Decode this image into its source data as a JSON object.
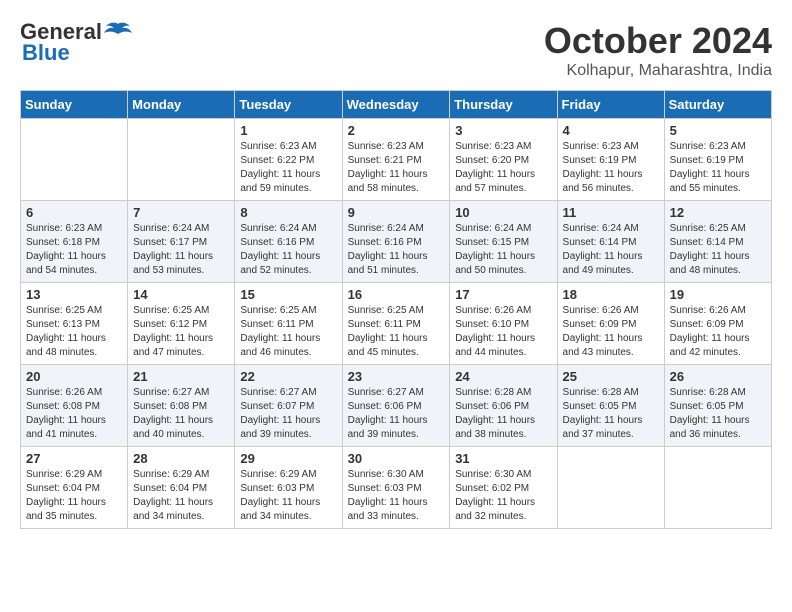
{
  "header": {
    "logo_line1": "General",
    "logo_line2": "Blue",
    "month_title": "October 2024",
    "location": "Kolhapur, Maharashtra, India"
  },
  "days_of_week": [
    "Sunday",
    "Monday",
    "Tuesday",
    "Wednesday",
    "Thursday",
    "Friday",
    "Saturday"
  ],
  "weeks": [
    [
      {
        "day": "",
        "sunrise": "",
        "sunset": "",
        "daylight": ""
      },
      {
        "day": "",
        "sunrise": "",
        "sunset": "",
        "daylight": ""
      },
      {
        "day": "1",
        "sunrise": "Sunrise: 6:23 AM",
        "sunset": "Sunset: 6:22 PM",
        "daylight": "Daylight: 11 hours and 59 minutes."
      },
      {
        "day": "2",
        "sunrise": "Sunrise: 6:23 AM",
        "sunset": "Sunset: 6:21 PM",
        "daylight": "Daylight: 11 hours and 58 minutes."
      },
      {
        "day": "3",
        "sunrise": "Sunrise: 6:23 AM",
        "sunset": "Sunset: 6:20 PM",
        "daylight": "Daylight: 11 hours and 57 minutes."
      },
      {
        "day": "4",
        "sunrise": "Sunrise: 6:23 AM",
        "sunset": "Sunset: 6:19 PM",
        "daylight": "Daylight: 11 hours and 56 minutes."
      },
      {
        "day": "5",
        "sunrise": "Sunrise: 6:23 AM",
        "sunset": "Sunset: 6:19 PM",
        "daylight": "Daylight: 11 hours and 55 minutes."
      }
    ],
    [
      {
        "day": "6",
        "sunrise": "Sunrise: 6:23 AM",
        "sunset": "Sunset: 6:18 PM",
        "daylight": "Daylight: 11 hours and 54 minutes."
      },
      {
        "day": "7",
        "sunrise": "Sunrise: 6:24 AM",
        "sunset": "Sunset: 6:17 PM",
        "daylight": "Daylight: 11 hours and 53 minutes."
      },
      {
        "day": "8",
        "sunrise": "Sunrise: 6:24 AM",
        "sunset": "Sunset: 6:16 PM",
        "daylight": "Daylight: 11 hours and 52 minutes."
      },
      {
        "day": "9",
        "sunrise": "Sunrise: 6:24 AM",
        "sunset": "Sunset: 6:16 PM",
        "daylight": "Daylight: 11 hours and 51 minutes."
      },
      {
        "day": "10",
        "sunrise": "Sunrise: 6:24 AM",
        "sunset": "Sunset: 6:15 PM",
        "daylight": "Daylight: 11 hours and 50 minutes."
      },
      {
        "day": "11",
        "sunrise": "Sunrise: 6:24 AM",
        "sunset": "Sunset: 6:14 PM",
        "daylight": "Daylight: 11 hours and 49 minutes."
      },
      {
        "day": "12",
        "sunrise": "Sunrise: 6:25 AM",
        "sunset": "Sunset: 6:14 PM",
        "daylight": "Daylight: 11 hours and 48 minutes."
      }
    ],
    [
      {
        "day": "13",
        "sunrise": "Sunrise: 6:25 AM",
        "sunset": "Sunset: 6:13 PM",
        "daylight": "Daylight: 11 hours and 48 minutes."
      },
      {
        "day": "14",
        "sunrise": "Sunrise: 6:25 AM",
        "sunset": "Sunset: 6:12 PM",
        "daylight": "Daylight: 11 hours and 47 minutes."
      },
      {
        "day": "15",
        "sunrise": "Sunrise: 6:25 AM",
        "sunset": "Sunset: 6:11 PM",
        "daylight": "Daylight: 11 hours and 46 minutes."
      },
      {
        "day": "16",
        "sunrise": "Sunrise: 6:25 AM",
        "sunset": "Sunset: 6:11 PM",
        "daylight": "Daylight: 11 hours and 45 minutes."
      },
      {
        "day": "17",
        "sunrise": "Sunrise: 6:26 AM",
        "sunset": "Sunset: 6:10 PM",
        "daylight": "Daylight: 11 hours and 44 minutes."
      },
      {
        "day": "18",
        "sunrise": "Sunrise: 6:26 AM",
        "sunset": "Sunset: 6:09 PM",
        "daylight": "Daylight: 11 hours and 43 minutes."
      },
      {
        "day": "19",
        "sunrise": "Sunrise: 6:26 AM",
        "sunset": "Sunset: 6:09 PM",
        "daylight": "Daylight: 11 hours and 42 minutes."
      }
    ],
    [
      {
        "day": "20",
        "sunrise": "Sunrise: 6:26 AM",
        "sunset": "Sunset: 6:08 PM",
        "daylight": "Daylight: 11 hours and 41 minutes."
      },
      {
        "day": "21",
        "sunrise": "Sunrise: 6:27 AM",
        "sunset": "Sunset: 6:08 PM",
        "daylight": "Daylight: 11 hours and 40 minutes."
      },
      {
        "day": "22",
        "sunrise": "Sunrise: 6:27 AM",
        "sunset": "Sunset: 6:07 PM",
        "daylight": "Daylight: 11 hours and 39 minutes."
      },
      {
        "day": "23",
        "sunrise": "Sunrise: 6:27 AM",
        "sunset": "Sunset: 6:06 PM",
        "daylight": "Daylight: 11 hours and 39 minutes."
      },
      {
        "day": "24",
        "sunrise": "Sunrise: 6:28 AM",
        "sunset": "Sunset: 6:06 PM",
        "daylight": "Daylight: 11 hours and 38 minutes."
      },
      {
        "day": "25",
        "sunrise": "Sunrise: 6:28 AM",
        "sunset": "Sunset: 6:05 PM",
        "daylight": "Daylight: 11 hours and 37 minutes."
      },
      {
        "day": "26",
        "sunrise": "Sunrise: 6:28 AM",
        "sunset": "Sunset: 6:05 PM",
        "daylight": "Daylight: 11 hours and 36 minutes."
      }
    ],
    [
      {
        "day": "27",
        "sunrise": "Sunrise: 6:29 AM",
        "sunset": "Sunset: 6:04 PM",
        "daylight": "Daylight: 11 hours and 35 minutes."
      },
      {
        "day": "28",
        "sunrise": "Sunrise: 6:29 AM",
        "sunset": "Sunset: 6:04 PM",
        "daylight": "Daylight: 11 hours and 34 minutes."
      },
      {
        "day": "29",
        "sunrise": "Sunrise: 6:29 AM",
        "sunset": "Sunset: 6:03 PM",
        "daylight": "Daylight: 11 hours and 34 minutes."
      },
      {
        "day": "30",
        "sunrise": "Sunrise: 6:30 AM",
        "sunset": "Sunset: 6:03 PM",
        "daylight": "Daylight: 11 hours and 33 minutes."
      },
      {
        "day": "31",
        "sunrise": "Sunrise: 6:30 AM",
        "sunset": "Sunset: 6:02 PM",
        "daylight": "Daylight: 11 hours and 32 minutes."
      },
      {
        "day": "",
        "sunrise": "",
        "sunset": "",
        "daylight": ""
      },
      {
        "day": "",
        "sunrise": "",
        "sunset": "",
        "daylight": ""
      }
    ]
  ]
}
